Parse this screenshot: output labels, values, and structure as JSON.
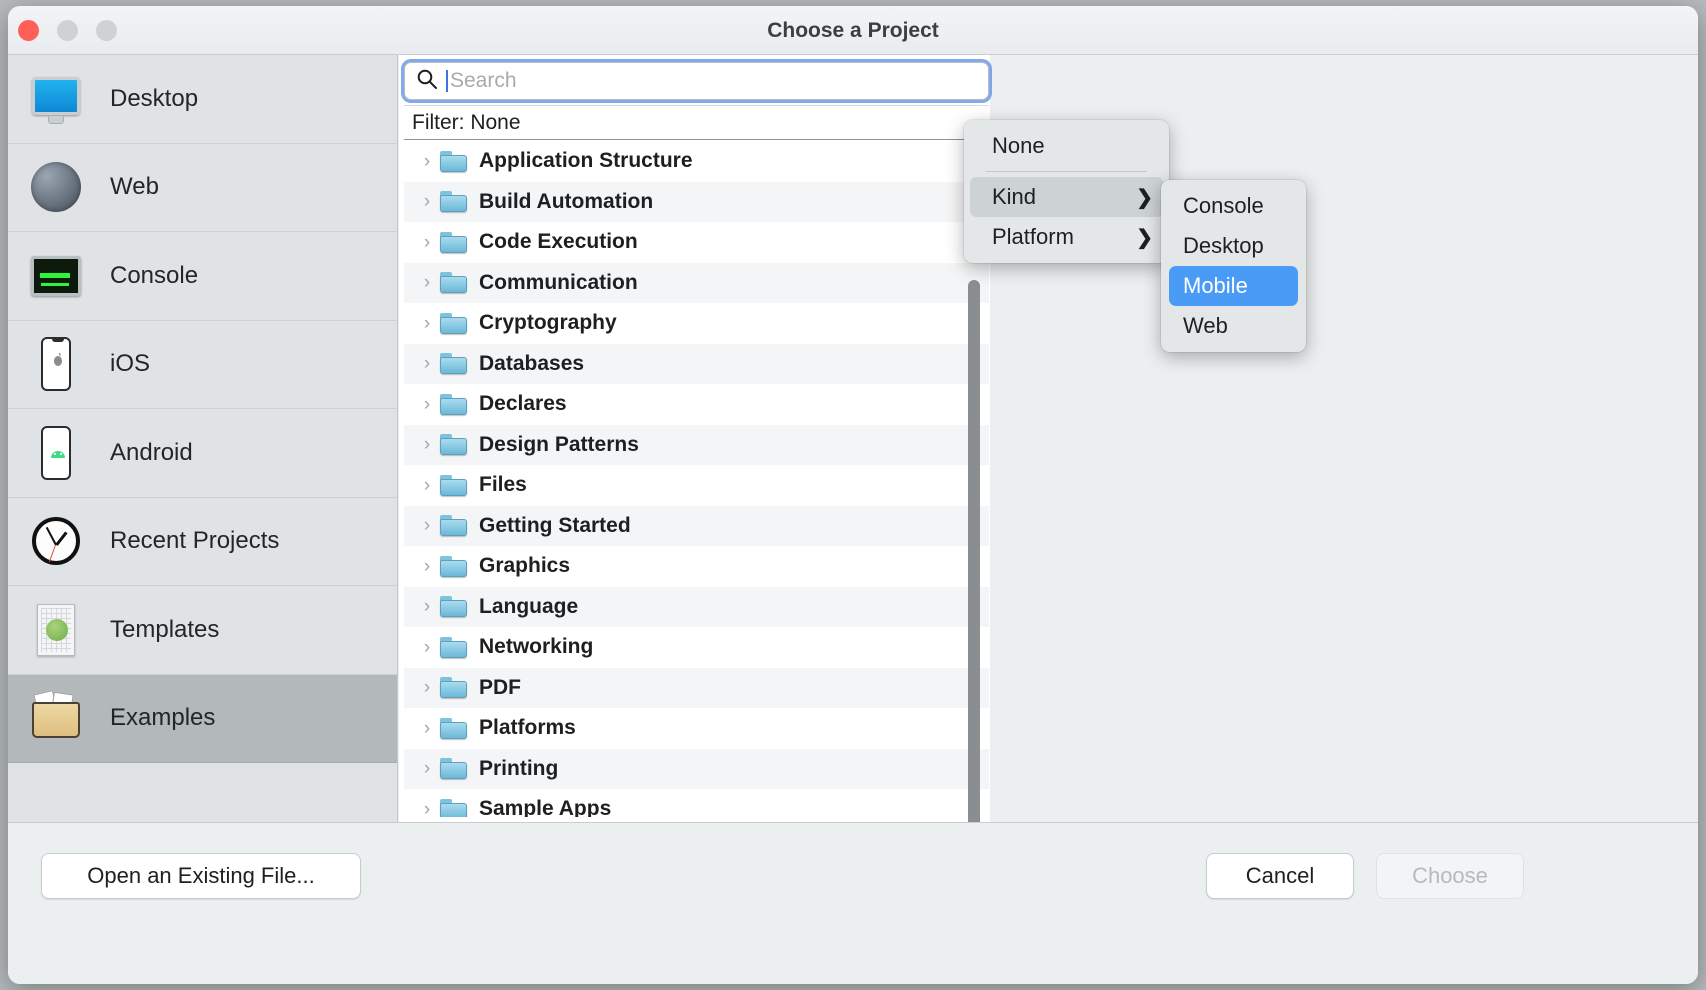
{
  "window": {
    "title": "Choose a Project",
    "traffic_lights": [
      "close",
      "minimize",
      "zoom"
    ]
  },
  "sidebar": {
    "items": [
      {
        "label": "Desktop",
        "icon": "desktop-icon",
        "selected": false
      },
      {
        "label": "Web",
        "icon": "globe-icon",
        "selected": false
      },
      {
        "label": "Console",
        "icon": "console-icon",
        "selected": false
      },
      {
        "label": "iOS",
        "icon": "ios-phone-icon",
        "selected": false
      },
      {
        "label": "Android",
        "icon": "android-phone-icon",
        "selected": false
      },
      {
        "label": "Recent Projects",
        "icon": "clock-icon",
        "selected": false
      },
      {
        "label": "Templates",
        "icon": "template-document-icon",
        "selected": false
      },
      {
        "label": "Examples",
        "icon": "open-folder-icon",
        "selected": true
      }
    ]
  },
  "search": {
    "value": "",
    "placeholder": "Search",
    "icon": "search-icon",
    "focused": true
  },
  "filter": {
    "label": "Filter: None"
  },
  "tree": {
    "rows": [
      {
        "label": "Application Structure"
      },
      {
        "label": "Build Automation"
      },
      {
        "label": "Code Execution"
      },
      {
        "label": "Communication"
      },
      {
        "label": "Cryptography"
      },
      {
        "label": "Databases"
      },
      {
        "label": "Declares"
      },
      {
        "label": "Design Patterns"
      },
      {
        "label": "Files"
      },
      {
        "label": "Getting Started"
      },
      {
        "label": "Graphics"
      },
      {
        "label": "Language"
      },
      {
        "label": "Networking"
      },
      {
        "label": "PDF"
      },
      {
        "label": "Platforms"
      },
      {
        "label": "Printing"
      },
      {
        "label": "Sample Apps"
      }
    ],
    "disclosure_glyph": "›"
  },
  "context_menu": {
    "items": [
      {
        "label": "None",
        "has_submenu": false,
        "highlighted": false
      },
      {
        "label": "Kind",
        "has_submenu": true,
        "highlighted": true
      },
      {
        "label": "Platform",
        "has_submenu": true,
        "highlighted": false
      }
    ],
    "arrow_glyph": "❯"
  },
  "submenu": {
    "items": [
      {
        "label": "Console",
        "selected": false
      },
      {
        "label": "Desktop",
        "selected": false
      },
      {
        "label": "Mobile",
        "selected": true
      },
      {
        "label": "Web",
        "selected": false
      }
    ]
  },
  "footer": {
    "open_existing": "Open an Existing File...",
    "cancel": "Cancel",
    "choose": "Choose",
    "choose_disabled": true
  },
  "colors": {
    "accent_selection": "#4a9bf5",
    "focus_ring": "#588ce6",
    "sidebar_bg": "#e0e3e5",
    "sidebar_selected": "#b3b8ba",
    "window_bg": "#eceff0",
    "folder_blue": "#6cb8d8"
  }
}
